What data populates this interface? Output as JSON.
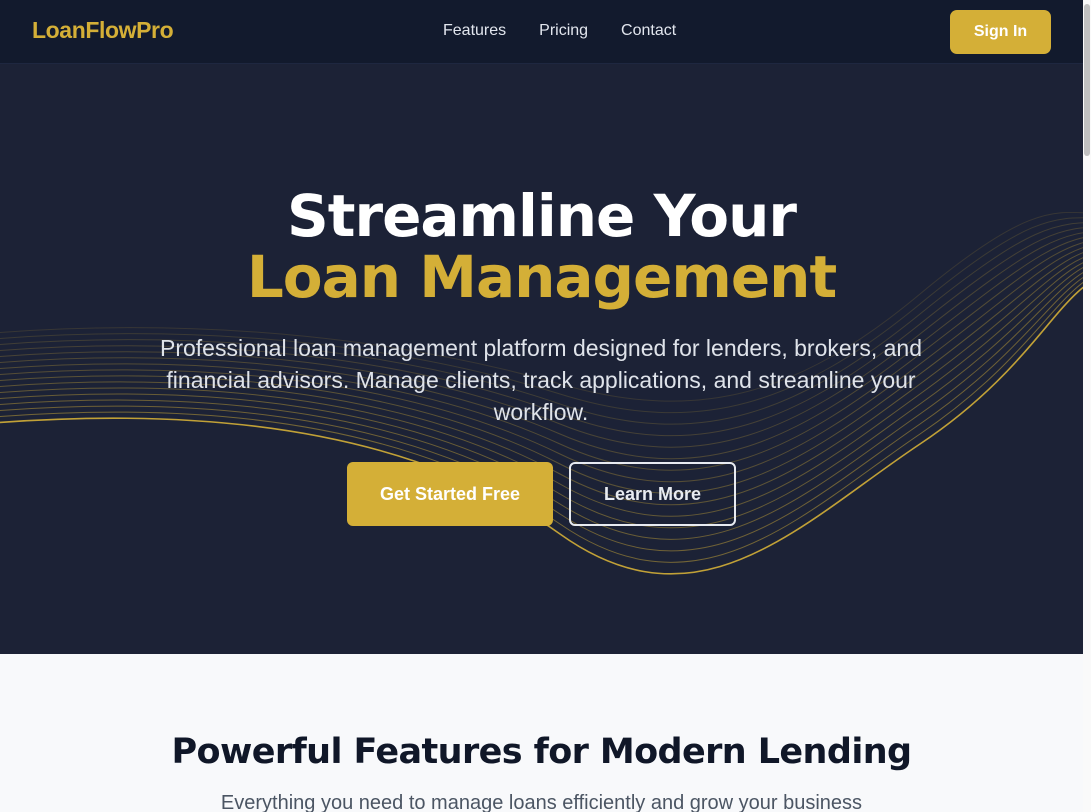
{
  "brand": {
    "name": "LoanFlowPro",
    "accent": "#d4af37",
    "nav_bg": "#121a2d",
    "hero_bg": "#1c2236"
  },
  "nav": {
    "links": [
      "Features",
      "Pricing",
      "Contact"
    ],
    "signin_label": "Sign In"
  },
  "hero": {
    "title_line1": "Streamline Your",
    "title_line2": "Loan Management",
    "subtitle": "Professional loan management platform designed for lenders, brokers, and financial advisors. Manage clients, track applications, and streamline your workflow.",
    "primary_cta": "Get Started Free",
    "secondary_cta": "Learn More"
  },
  "features": {
    "title": "Powerful Features for Modern Lending",
    "subtitle": "Everything you need to manage loans efficiently and grow your business"
  }
}
